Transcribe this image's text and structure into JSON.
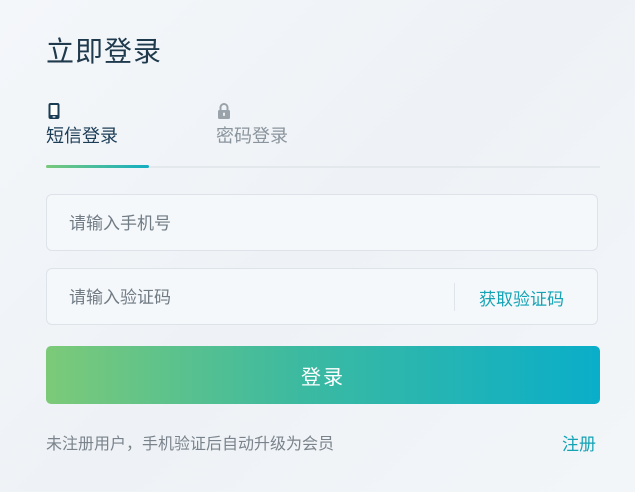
{
  "header": {
    "title": "立即登录"
  },
  "tabs": [
    {
      "label": "短信登录",
      "icon": "phone-icon",
      "active": true
    },
    {
      "label": "密码登录",
      "icon": "lock-icon",
      "active": false
    }
  ],
  "form": {
    "phone_placeholder": "请输入手机号",
    "phone_value": "",
    "code_placeholder": "请输入验证码",
    "code_value": "",
    "get_code_label": "获取验证码",
    "submit_label": "登录"
  },
  "footer": {
    "note": "未注册用户，手机验证后自动升级为会员",
    "register_label": "注册"
  },
  "colors": {
    "accent": "#14a3b5",
    "gradient_start": "#7cca78",
    "gradient_end": "#0aaec9",
    "title": "#1f3a4d"
  }
}
